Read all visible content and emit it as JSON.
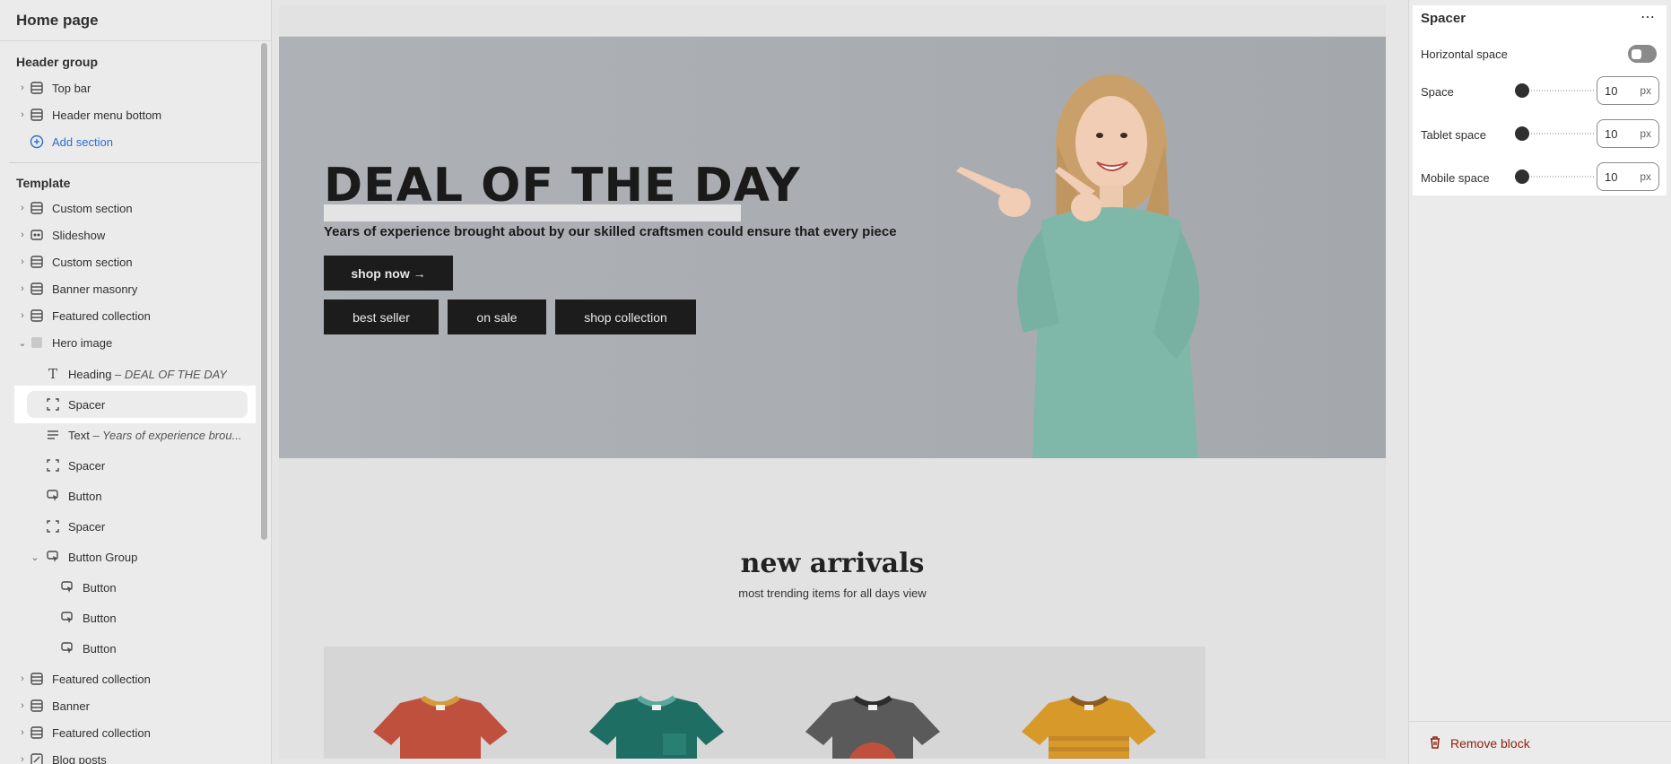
{
  "sidebar": {
    "title": "Home page",
    "header_group": {
      "title": "Header group",
      "items": [
        {
          "label": "Top bar"
        },
        {
          "label": "Header menu bottom"
        }
      ],
      "add_label": "Add section"
    },
    "template": {
      "title": "Template",
      "items": [
        {
          "label": "Custom section"
        },
        {
          "label": "Slideshow"
        },
        {
          "label": "Custom section"
        },
        {
          "label": "Banner masonry"
        },
        {
          "label": "Featured collection"
        },
        {
          "label": "Hero image"
        }
      ],
      "hero_children": [
        {
          "label": "Heading",
          "sub": " – DEAL OF THE DAY"
        },
        {
          "label": "Spacer",
          "sub": ""
        },
        {
          "label": "Text",
          "sub": " – Years of experience brou..."
        },
        {
          "label": "Spacer",
          "sub": ""
        },
        {
          "label": "Button",
          "sub": ""
        },
        {
          "label": "Spacer",
          "sub": ""
        },
        {
          "label": "Button Group",
          "sub": ""
        }
      ],
      "button_group_children": [
        {
          "label": "Button"
        },
        {
          "label": "Button"
        },
        {
          "label": "Button"
        }
      ],
      "after_items": [
        {
          "label": "Featured collection"
        },
        {
          "label": "Banner"
        },
        {
          "label": "Featured collection"
        },
        {
          "label": "Blog posts"
        }
      ]
    }
  },
  "preview": {
    "hero": {
      "heading": "DEAL OF THE DAY",
      "text": "Years of experience brought about by our skilled craftsmen could ensure that every piece",
      "primary_button": "shop now →",
      "buttons": [
        "best seller",
        "on sale",
        "shop collection"
      ]
    },
    "new_arrivals": {
      "title": "new arrivals",
      "subtitle": "most trending items for all days view"
    },
    "accent_colors": [
      "#c0503e",
      "#1f6e63",
      "#5a5a5a",
      "#d79a2a"
    ]
  },
  "panel": {
    "title": "Spacer",
    "more_icon": "⋯",
    "horizontal_space_label": "Horizontal space",
    "horizontal_space_on": false,
    "settings": [
      {
        "label": "Space",
        "value": "10",
        "unit": "px"
      },
      {
        "label": "Tablet space",
        "value": "10",
        "unit": "px"
      },
      {
        "label": "Mobile space",
        "value": "10",
        "unit": "px"
      }
    ],
    "remove_label": "Remove block"
  }
}
